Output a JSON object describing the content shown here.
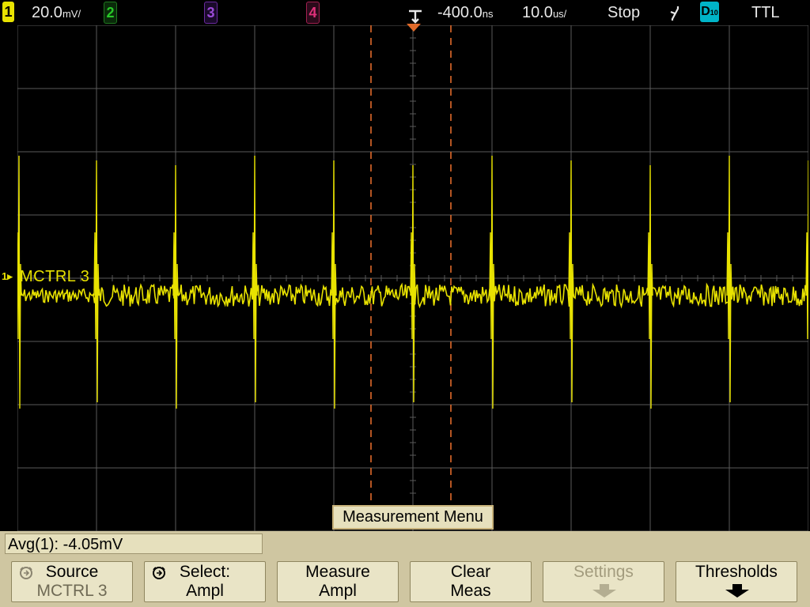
{
  "status": {
    "ch1_label": "1",
    "ch1_scale": "20.0",
    "ch1_scale_unit": "mV/",
    "ch2_label": "2",
    "ch3_label": "3",
    "ch4_label": "4",
    "time_offset": "-400.0",
    "time_offset_unit": "ns",
    "timebase": "10.0",
    "timebase_unit": "us/",
    "run_state": "Stop",
    "trigger_edge_icon": "falling-edge-icon",
    "digital_label": "D",
    "digital_sub": "10",
    "trigger_level": "TTL"
  },
  "waveform": {
    "channel_marker": "1",
    "label": "MCTRL 3",
    "color": "#e8e200"
  },
  "menu": {
    "title": "Measurement Menu",
    "readout": "Avg(1): -4.05mV",
    "softkeys": [
      {
        "line1": "Source",
        "line2": "MCTRL 3",
        "icon": "knob-icon"
      },
      {
        "line1": "Select:",
        "line2": "Ampl",
        "icon": "knob-icon"
      },
      {
        "line1": "Measure",
        "line2": "Ampl"
      },
      {
        "line1": "Clear",
        "line2": "Meas"
      },
      {
        "line1": "Settings",
        "line2": "",
        "icon": "down-arrow-icon",
        "disabled": true
      },
      {
        "line1": "Thresholds",
        "line2": "",
        "icon": "down-arrow-icon"
      }
    ]
  },
  "colors": {
    "ch1": "#e8e200",
    "ch2": "#28c728",
    "ch3": "#9b4ad6",
    "ch4": "#e0307a",
    "cursor": "#e06a2a",
    "grid": "#5a5a5a",
    "menu_bg": "#cfc6a1"
  }
}
